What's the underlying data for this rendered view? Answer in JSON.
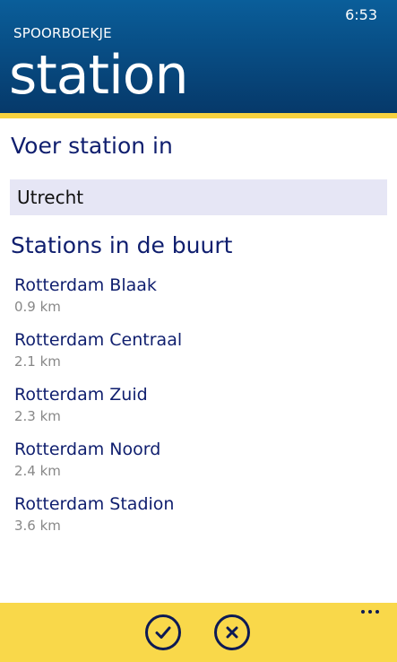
{
  "status": {
    "time": "6:53"
  },
  "app": {
    "name": "SPOORBOEKJE",
    "page_title": "station"
  },
  "enter": {
    "heading": "Voer station in",
    "value": "Utrecht"
  },
  "nearby": {
    "heading": "Stations in de buurt",
    "stations": [
      {
        "name": "Rotterdam Blaak",
        "distance": "0.9 km"
      },
      {
        "name": "Rotterdam Centraal",
        "distance": "2.1 km"
      },
      {
        "name": "Rotterdam Zuid",
        "distance": "2.3 km"
      },
      {
        "name": "Rotterdam Noord",
        "distance": "2.4 km"
      },
      {
        "name": "Rotterdam Stadion",
        "distance": "3.6 km"
      }
    ]
  },
  "app_bar": {
    "ok_icon": "checkmark-icon",
    "cancel_icon": "close-icon",
    "more_icon": "ellipsis-icon"
  },
  "colors": {
    "header": "#084d84",
    "accent": "#f7d23f",
    "app_bar": "#f9d84a",
    "text_dark": "#0f1e6e"
  }
}
